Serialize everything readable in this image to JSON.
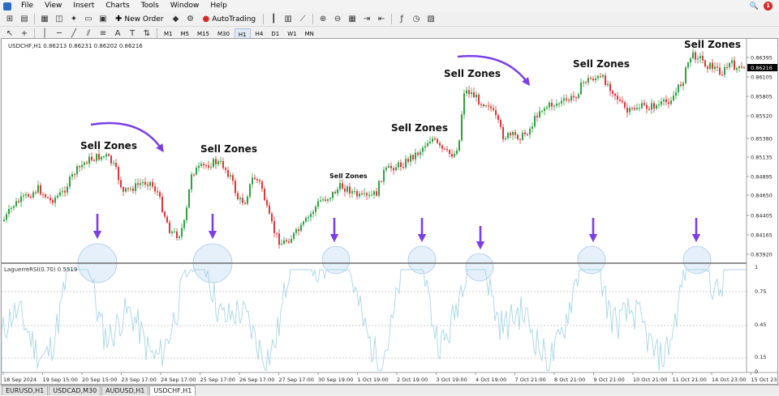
{
  "menu": {
    "items": [
      "File",
      "View",
      "Insert",
      "Charts",
      "Tools",
      "Window",
      "Help"
    ]
  },
  "toolbar": {
    "new_order": "New Order",
    "autotrading": "AutoTrading"
  },
  "timeframes": [
    "M1",
    "M5",
    "M15",
    "M30",
    "H1",
    "H4",
    "D1",
    "W1",
    "MN"
  ],
  "active_timeframe": "H1",
  "chart": {
    "info": "USDCHF,H1  0.86213 0.86231 0.86202 0.86216",
    "current_price": "0.86216",
    "price_labels": [
      "0.86395",
      "0.86105",
      "0.85805",
      "0.85520",
      "0.85380",
      "0.85135",
      "0.84895",
      "0.84650",
      "0.84405",
      "0.84165",
      "0.83920"
    ],
    "indicator_info": "LaguerreRSI(0.70) 0.5519",
    "indicator_labels": [
      "1",
      "0.75",
      "0.45",
      "0.15",
      "0"
    ],
    "time_labels": [
      "18 Sep 2024",
      "19 Sep 15:00",
      "20 Sep 15:00",
      "23 Sep 17:00",
      "24 Sep 17:00",
      "25 Sep 17:00",
      "26 Sep 17:00",
      "27 Sep 17:00",
      "30 Sep 19:00",
      "1 Oct 19:00",
      "2 Oct 19:00",
      "3 Oct 19:00",
      "4 Oct 19:00",
      "7 Oct 21:00",
      "8 Oct 21:00",
      "9 Oct 21:00",
      "10 Oct 21:00",
      "11 Oct 21:00",
      "14 Oct 23:00",
      "15 Oct 23:00"
    ],
    "annotations": [
      "Sell Zones",
      "Sell Zones",
      "Sell Zones",
      "Sell Zones",
      "Sell Zones",
      "Sell Zones",
      "Sell Zones"
    ],
    "colors": {
      "bull": "#2ea043",
      "bear": "#d9383a",
      "indicator": "#a9d6e6",
      "annotation": "#7b3fe4",
      "zone_fill": "#cfe3f5"
    }
  },
  "tabs": [
    "EURUSD,H1",
    "USDCAD,M30",
    "AUDUSD,H1",
    "USDCHF,H1"
  ],
  "active_tab": "USDCHF,H1"
}
